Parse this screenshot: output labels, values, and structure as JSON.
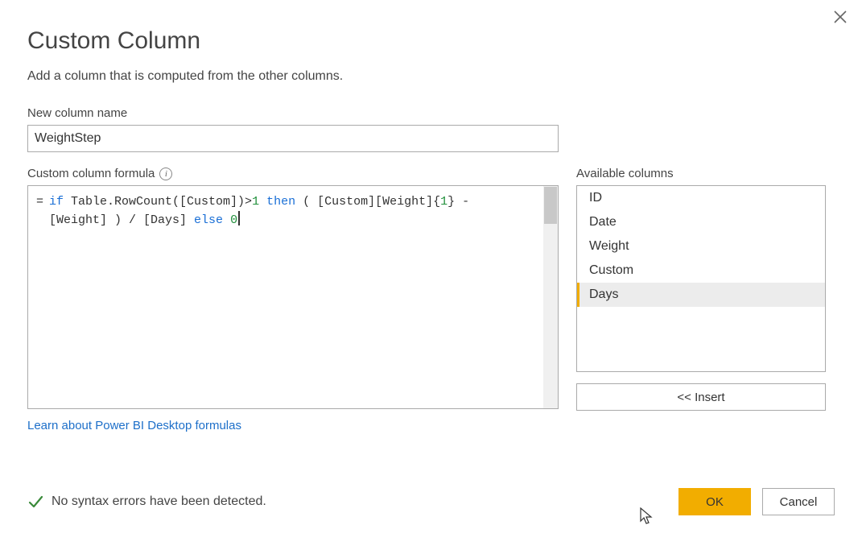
{
  "dialog": {
    "title": "Custom Column",
    "subtitle": "Add a column that is computed from the other columns.",
    "close_icon": "close"
  },
  "new_column": {
    "label": "New column name",
    "value": "WeightStep"
  },
  "formula": {
    "label": "Custom column formula",
    "tokens": [
      {
        "t": "kw",
        "v": "if"
      },
      {
        "t": "plain",
        "v": " Table.RowCount([Custom])>"
      },
      {
        "t": "num",
        "v": "1"
      },
      {
        "t": "plain",
        "v": " "
      },
      {
        "t": "kw",
        "v": "then"
      },
      {
        "t": "plain",
        "v": " ( [Custom][Weight]{"
      },
      {
        "t": "num",
        "v": "1"
      },
      {
        "t": "plain",
        "v": "} -\n[Weight] ) / [Days] "
      },
      {
        "t": "kw",
        "v": "else"
      },
      {
        "t": "plain",
        "v": " "
      },
      {
        "t": "num",
        "v": "0"
      }
    ]
  },
  "available": {
    "label": "Available columns",
    "items": [
      {
        "name": "ID",
        "selected": false
      },
      {
        "name": "Date",
        "selected": false
      },
      {
        "name": "Weight",
        "selected": false
      },
      {
        "name": "Custom",
        "selected": false
      },
      {
        "name": "Days",
        "selected": true
      }
    ],
    "insert_label": "<< Insert"
  },
  "link": {
    "label": "Learn about Power BI Desktop formulas"
  },
  "status": {
    "message": "No syntax errors have been detected.",
    "ok": true
  },
  "buttons": {
    "ok": "OK",
    "cancel": "Cancel"
  }
}
